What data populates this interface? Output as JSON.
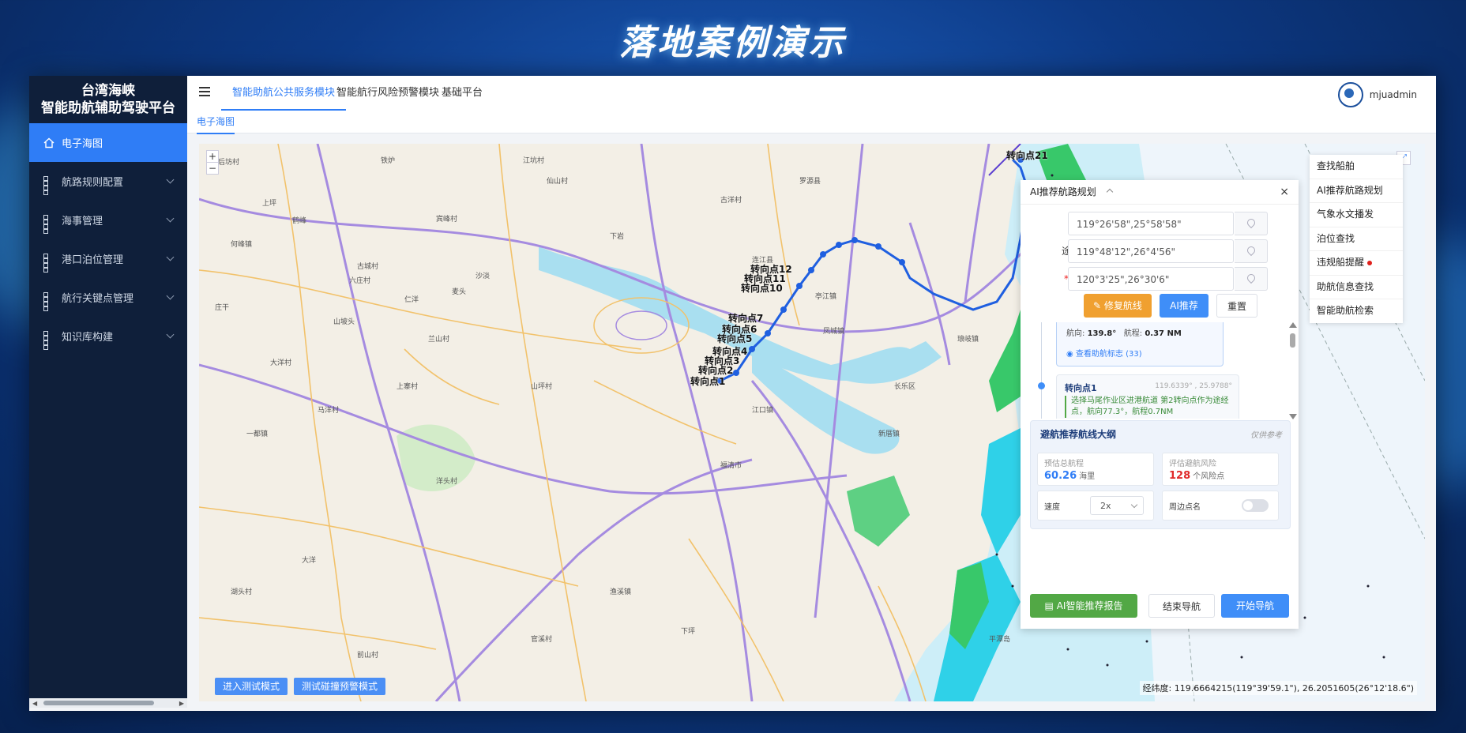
{
  "slide_title": "落地案例演示",
  "brand": {
    "line1": "台湾海峡",
    "line2": "智能助航辅助驾驶平台"
  },
  "sidebar": {
    "items": [
      {
        "label": "电子海图",
        "active": true
      },
      {
        "label": "航路规则配置"
      },
      {
        "label": "海事管理"
      },
      {
        "label": "港口泊位管理"
      },
      {
        "label": "航行关键点管理"
      },
      {
        "label": "知识库构建"
      }
    ]
  },
  "topbar": {
    "tabs": [
      "智能助航公共服务模块",
      "智能航行风险预警模块",
      "基础平台"
    ],
    "active_tab": 0,
    "user": "mjuadmin"
  },
  "subtabs": {
    "current": "电子海图"
  },
  "map": {
    "zoom_in": "+",
    "zoom_out": "−",
    "coord_text": "经纬度: 119.6664215(119°39'59.1\"), 26.2051605(26°12'18.6\")",
    "btn_test_mode": "进入测试模式",
    "btn_collision_mode": "测试碰撞预警模式",
    "waypoint_labels": [
      "转向点21",
      "转向点12",
      "转向点11",
      "转向点10",
      "转向点7",
      "转向点6",
      "转向点5",
      "转向点4",
      "转向点3",
      "转向点2",
      "转向点1"
    ],
    "place_labels": [
      "后坊村",
      "上坪",
      "铁炉",
      "江坑村",
      "仙山村",
      "宾峰村",
      "下岩",
      "何峰镇",
      "古城村",
      "古洋村",
      "六庄村",
      "鹤峰",
      "仁洋",
      "麦头",
      "沙淡",
      "庄干",
      "山坡头",
      "亭江镇",
      "兰山村",
      "大洋村",
      "上寨村",
      "马洋村",
      "山坪村",
      "长乐区",
      "福清市",
      "江口镇",
      "新厝镇",
      "平潭岛",
      "一都镇",
      "渔溪镇",
      "洋头村",
      "官溪村",
      "大洋",
      "下坪",
      "前山村",
      "湖头村",
      "罗源县",
      "连江县",
      "凤城镇",
      "琅岐镇"
    ],
    "colors": {
      "land": "#f3efe6",
      "sea_shallow": "#c8ecf7",
      "sea_green": "#38c86a",
      "sea_cyan": "#2fd1e8",
      "road_major": "#a58be0",
      "road_minor": "#f2c26b",
      "route": "#1f5fe0"
    }
  },
  "quick_menu": [
    "查找船舶",
    "AI推荐航路规划",
    "气象水文播发",
    "泊位查找",
    "违规船提醒",
    "助航信息查找",
    "智能助航检索"
  ],
  "panel": {
    "title": "AI推荐航路规划",
    "close": "×",
    "fields": [
      {
        "label": "起点",
        "value": "119°26'58\",25°58'58\"",
        "required": false
      },
      {
        "label": "途径点",
        "value": "119°48'12\",26°4'56\"",
        "required": false
      },
      {
        "label": "终点",
        "value": "120°3'25\",26°30'6\"",
        "required": true
      }
    ],
    "btn_repair": "修复航线",
    "btn_ai": "AI推荐",
    "btn_reset": "重置",
    "timeline": {
      "heading_label": "航向:",
      "heading_value": "139.8°",
      "range_label": "航程:",
      "range_value": "0.37 NM",
      "view_marks": "查看助航标志 (33)",
      "point_name": "转向点1",
      "point_coord": "119.6339° , 25.9788°",
      "point_desc": "选择马尾作业区进港航道 第2转向点作为途经点，航向77.3°，航程0.7NM"
    },
    "outline": {
      "title": "避航推荐航线大纲",
      "note": "仅供参考",
      "dist_label": "预估总航程",
      "dist_value": "60.26",
      "dist_unit": "海里",
      "risk_label": "评估避航风险",
      "risk_value": "128",
      "risk_unit": "个风险点",
      "speed_label": "速度",
      "speed_value": "2x",
      "nearby_label": "周边点名"
    },
    "btn_report": "AI智能推荐报告",
    "btn_end": "结束导航",
    "btn_start": "开始导航"
  }
}
